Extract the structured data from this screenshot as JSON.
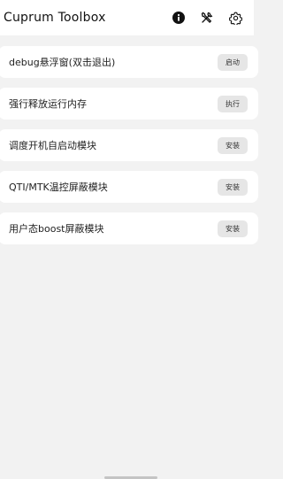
{
  "header": {
    "title": "Cuprum Toolbox",
    "icons": [
      "info-icon",
      "tools-icon",
      "settings-icon"
    ]
  },
  "items": [
    {
      "label": "debug悬浮窗(双击退出)",
      "button": "启动"
    },
    {
      "label": "强行释放运行内存",
      "button": "执行"
    },
    {
      "label": "调度开机自启动模块",
      "button": "安装"
    },
    {
      "label": "QTI/MTK温控屏蔽模块",
      "button": "安装"
    },
    {
      "label": "用户态boost屏蔽模块",
      "button": "安装"
    }
  ],
  "colors": {
    "background": "#f2f2f2",
    "card": "#ffffff",
    "button": "#e6e6e6"
  }
}
